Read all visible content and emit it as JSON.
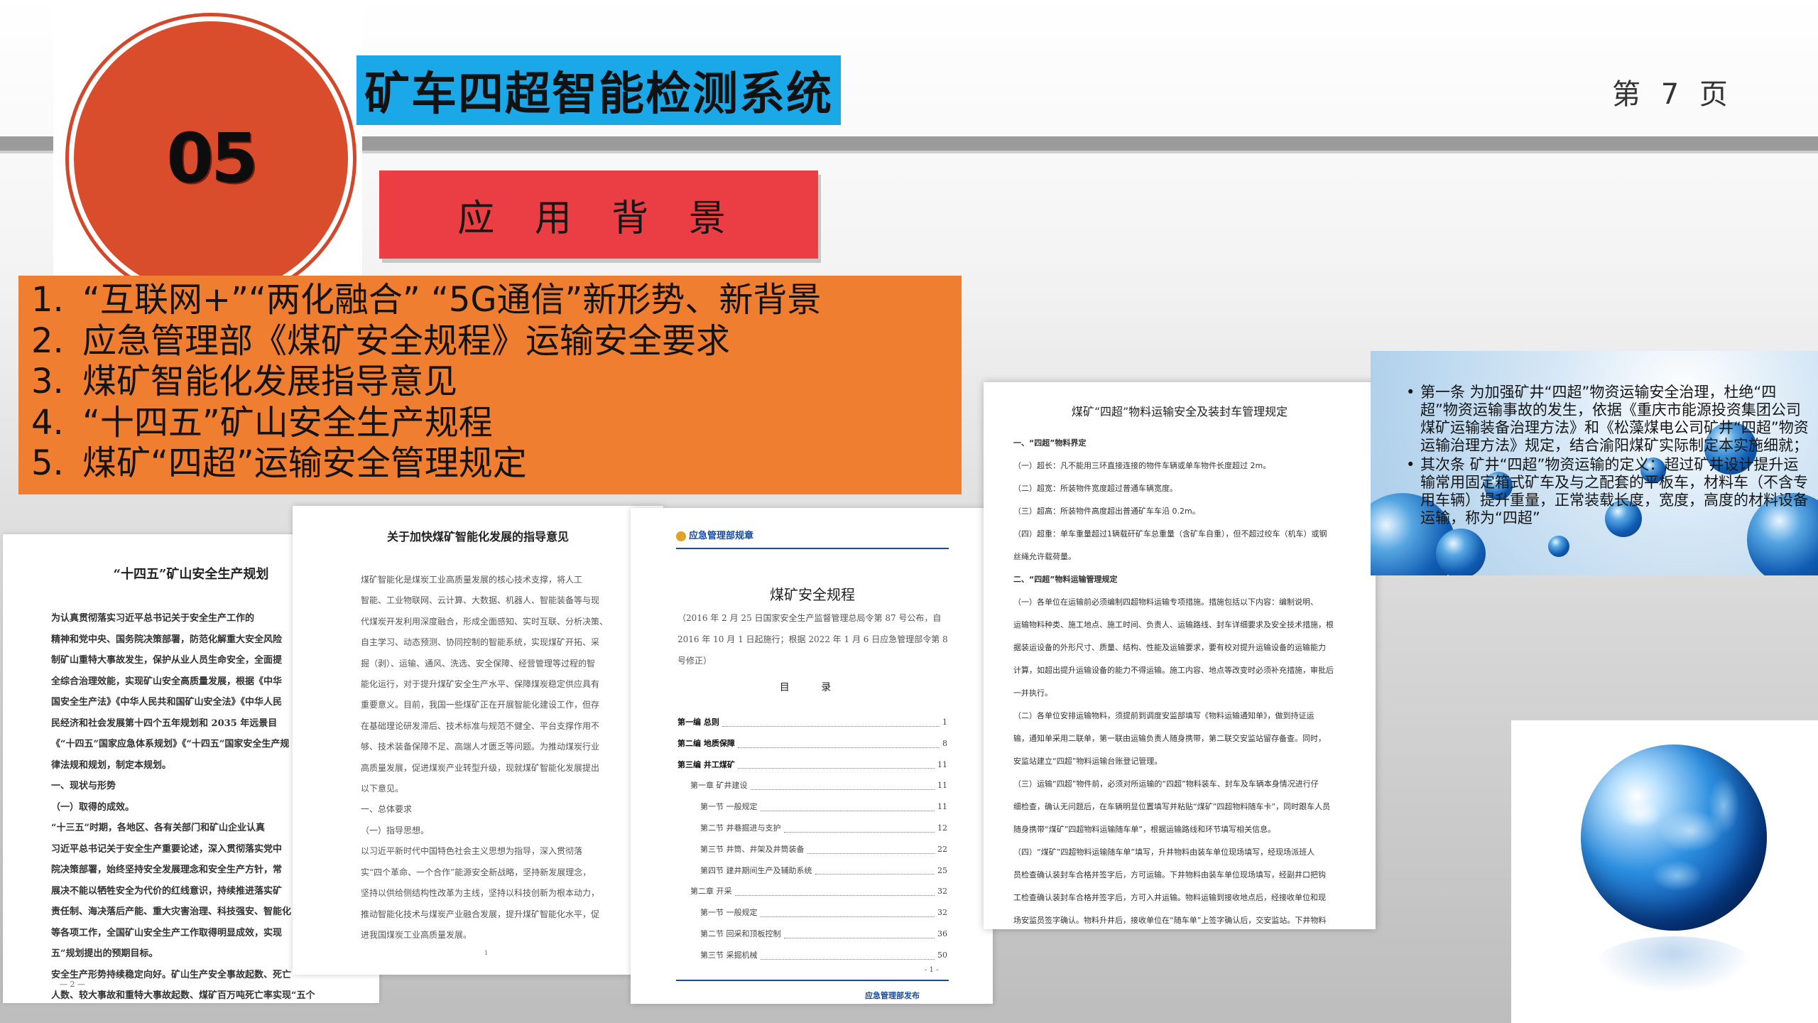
{
  "header": {
    "title": "矿车四超智能检测系统",
    "page_indicator": "第 7 页",
    "section_number": "05"
  },
  "section": {
    "label": "应 用 背 景"
  },
  "background_list": [
    {
      "num": "1.",
      "text": "“互联网+”“两化融合” “5G通信”新形势、新背景"
    },
    {
      "num": "2.",
      "text": "应急管理部《煤矿安全规程》运输安全要求"
    },
    {
      "num": "3.",
      "text": "煤矿智能化发展指导意见"
    },
    {
      "num": "4.",
      "text": "“十四五”矿山安全生产规程"
    },
    {
      "num": "5.",
      "text": "煤矿“四超”运输安全管理规定"
    }
  ],
  "documents": {
    "plan": {
      "title": "“十四五”矿山安全生产规划",
      "lines": [
        "为认真贯彻落实习近平总书记关于安全生产工作的",
        "精神和党中央、国务院决策部署，防范化解重大安全风险",
        "制矿山重特大事故发生，保护从业人员生命安全，全面提",
        "全综合治理效能，实现矿山安全高质量发展，根据《中华",
        "国安全生产法》《中华人民共和国矿山安全法》《中华人民",
        "民经济和社会发展第十四个五年规划和 2035 年远景目",
        "《“十四五”国家应急体系规划》《“十四五”国家安全生产规",
        "律法规和规划，制定本规划。",
        "一、现状与形势",
        "（一）取得的成效。",
        "“十三五”时期，各地区、各有关部门和矿山企业认真",
        "习近平总书记关于安全生产重要论述，深入贯彻落实党中",
        "院决策部署，始终坚持安全发展理念和安全生产方针，常",
        "展决不能以牺牲安全为代价的红线意识，持续推进落实矿",
        "责任制、海决落后产能、重大灾害治理、科技强安、智能化",
        "等各项工作，全国矿山安全生产工作取得明显成效，实现",
        "五”规划提出的预期目标。",
        "安全生产形势持续稳定向好。矿山生产安全事故起数、死亡",
        "人数、较大事故和重特大事故起数、煤矿百万吨死亡率实现“五个"
      ],
      "footer": "— 2 —"
    },
    "opinion": {
      "title": "关于加快煤矿智能化发展的指导意见",
      "lines": [
        "煤矿智能化是煤炭工业高质量发展的核心技术支撑，将人工",
        "智能、工业物联网、云计算、大数据、机器人、智能装备等与现",
        "代煤炭开发利用深度融合，形成全面感知、实时互联、分析决策、",
        "自主学习、动态预测、协同控制的智能系统，实现煤矿开拓、采",
        "掘（剥）、运输、通风、洗选、安全保障、经营管理等过程的智",
        "能化运行，对于提升煤矿安全生产水平、保障煤炭稳定供应具有",
        "重要意义。目前，我国一些煤矿正在开展智能化建设工作，但存",
        "在基础理论研发滞后、技术标准与规范不健全、平台支撑作用不",
        "够、技术装备保障不足、高端人才匮乏等问题。为推动煤炭行业",
        "高质量发展，促进煤炭产业转型升级，现就煤矿智能化发展提出",
        "以下意见。",
        "一、总体要求",
        "（一）指导思想。",
        "以习近平新时代中国特色社会主义思想为指导，深入贯彻落",
        "实“四个革命、一个合作”能源安全新战略，坚持新发展理念，",
        "坚持以供给侧结构性改革为主线，坚持以科技创新为根本动力，",
        "推动智能化技术与煤炭产业融合发展，提升煤矿智能化水平，促",
        "进我国煤炭工业高质量发展。"
      ],
      "footer": "1"
    },
    "regulation": {
      "header": "应急管理部规章",
      "title": "煤矿安全规程",
      "note": "（2016 年 2 月 25 日国家安全生产监督管理总局令第 87 号公布，自 2016 年 10 月 1 日起施行；根据 2022 年 1 月 6 日应急管理部令第 8 号修正）",
      "toc_title": "目 录",
      "toc": [
        {
          "text": "第一编 总则",
          "page": "1",
          "level": "bold"
        },
        {
          "text": "第二编 地质保障",
          "page": "8",
          "level": "bold"
        },
        {
          "text": "第三编 井工煤矿",
          "page": "11",
          "level": "bold"
        },
        {
          "text": "第一章 矿井建设",
          "page": "11",
          "level": "sub"
        },
        {
          "text": "第一节 一般规定",
          "page": "11",
          "level": "subsub"
        },
        {
          "text": "第二节 井巷掘进与支护",
          "page": "12",
          "level": "subsub"
        },
        {
          "text": "第三节 井筒、井架及井筒装备",
          "page": "22",
          "level": "subsub"
        },
        {
          "text": "第四节 建井期间生产及辅助系统",
          "page": "25",
          "level": "subsub"
        },
        {
          "text": "第二章 开采",
          "page": "32",
          "level": "sub"
        },
        {
          "text": "第一节 一般规定",
          "page": "32",
          "level": "subsub"
        },
        {
          "text": "第二节 回采和顶板控制",
          "page": "36",
          "level": "subsub"
        },
        {
          "text": "第三节 采掘机械",
          "page": "50",
          "level": "subsub"
        }
      ],
      "page_mark": "- 1 -",
      "publisher": "应急管理部发布"
    },
    "management": {
      "title": "煤矿“四超”物料运输安全及装封车管理规定",
      "lines": [
        {
          "text": "一、“四超”物料界定",
          "h": true
        },
        {
          "text": "（一）超长：凡不能用三环直接连接的物件车辆或单车物件长度超过        2m。",
          "h": false
        },
        {
          "text": "（二）超宽：所装物件宽度超过普通车辆宽度。",
          "h": false
        },
        {
          "text": "（三）超高：所装物件高度超出普通矿车车沿 0.2m。",
          "h": false
        },
        {
          "text": "（四）超重：单车重量超过1辆载矸矿车总重量（含矿车自重），但不超过绞车（机车）或钢",
          "h": false
        },
        {
          "text": "丝绳允许载荷量。",
          "h": false
        },
        {
          "text": "二、“四超”物料运输管理规定",
          "h": true
        },
        {
          "text": "（一）各单位在运输前必须编制四超物料运输专项措施。措施包括以下内容：编制说明、",
          "h": false
        },
        {
          "text": "运输物料种类、施工地点、施工时间、负责人、运输路线、封车详细要求及安全技术措施，根",
          "h": false
        },
        {
          "text": "据装运设备的外形尺寸、质量、结构、性能及运输要求，要有校对提升运输设备的运输能力",
          "h": false
        },
        {
          "text": "计算，如超出提升运输设备的能力不得运输。施工内容、地点等改变时必须补充措施，审批后",
          "h": false
        },
        {
          "text": "一并执行。",
          "h": false
        },
        {
          "text": "（二）各单位安排运输物料，须提前到调度安监部填写《物料运输通知单》，做到持证运",
          "h": false
        },
        {
          "text": "输，通知单采用二联单，第一联由运输负责人随身携带，第二联交安监站留存备查。同时，",
          "h": false
        },
        {
          "text": "安监站建立“四超”物料运输台账登记管理。",
          "h": false
        },
        {
          "text": "（三）运输“四超”物件前，必须对所运输的“四超”物料装车、封车及车辆本身情况进行仔",
          "h": false
        },
        {
          "text": "细检查，确认无问题后，在车辆明显位置填写并粘贴“煤矿”四超物料随车卡”，同时跟车人员",
          "h": false
        },
        {
          "text": "随身携带“煤矿”四超物料运输随车单”，根据运输路线和环节填写相关信息。",
          "h": false
        },
        {
          "text": "（四）“煤矿”四超物料运输随车单”填写，升井物料由装车单位现场填写，经现场派班人",
          "h": false
        },
        {
          "text": "员检查确认装封车合格并签字后，方可运输。下井物料由装车单位现场填写，经副井口把钩",
          "h": false
        },
        {
          "text": "工检查确认装封车合格并签字后，方可入井运输。物料运输到接收地点后，经接收单位和现",
          "h": false
        },
        {
          "text": "场安监员签字确认。物料升井后，接收单位在“随车单”上签字确认后，交安监站。下井物料",
          "h": false
        }
      ]
    }
  },
  "rules_panel": {
    "paragraphs": [
      "第一条  为加强矿井“四超”物资运输安全治理，杜绝“四超”物资运输事故的发生，依据《重庆市能源投资集团公司煤矿运输装备治理方法》和《松藻煤电公司矿井“四超”物资运输治理方法》规定，结合渝阳煤矿实际制定本实施细就；",
      "其次条  矿井“四超”物资运输的定义：超过矿井设计提升运输常用固定箱式矿车及与之配套的平板车，材料车（不含专用车辆）提升重量，正常装载长度，宽度，高度的材料设备运输，称为“四超”"
    ]
  },
  "colors": {
    "title_bg": "#1ba8e8",
    "section_bg": "#ea3d44",
    "list_bg": "#ef7e31",
    "circle": "#da4d2c"
  },
  "icons": [
    "globe-icon",
    "emblem-icon"
  ]
}
